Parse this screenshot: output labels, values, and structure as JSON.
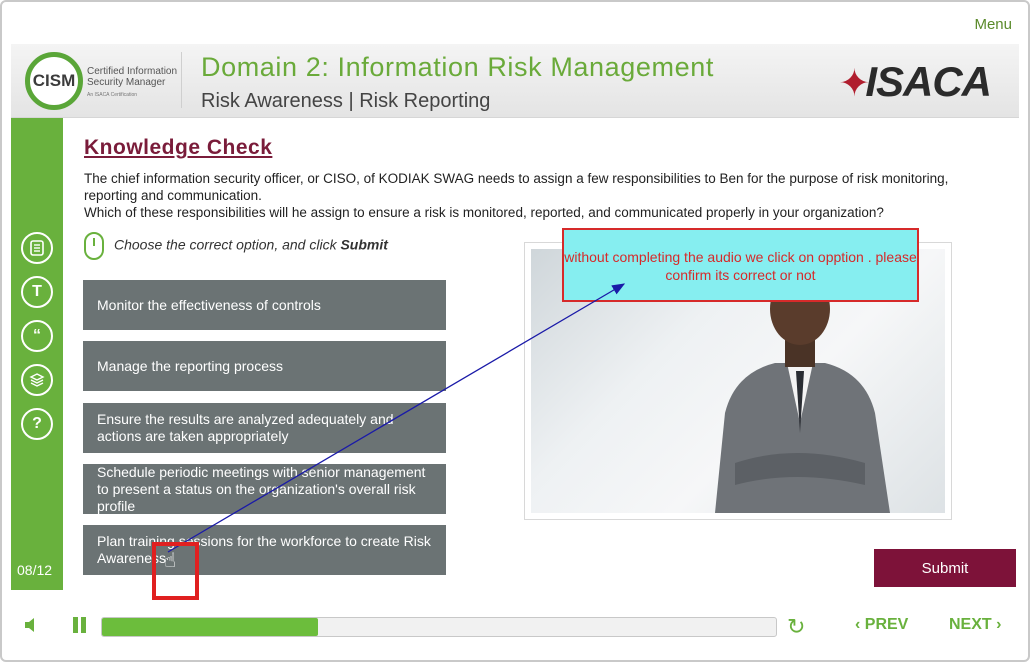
{
  "menu_label": "Menu",
  "header": {
    "cism_badge": "CISM",
    "cism_line1": "Certified Information",
    "cism_line2": "Security Manager",
    "cism_sub": "An ISACA Certification",
    "domain_title": "Domain 2: Information Risk Management",
    "domain_subtitle": "Risk Awareness | Risk Reporting",
    "brand": "ISACA"
  },
  "sidebar": {
    "icons": [
      "notes-icon",
      "transcript-icon",
      "quote-icon",
      "resources-icon",
      "help-icon"
    ],
    "page_counter": "08/12"
  },
  "main": {
    "kc_title": "Knowledge Check",
    "question_line1": "The chief information security officer, or CISO, of KODIAK SWAG needs to assign a few responsibilities to Ben for the purpose of risk monitoring, reporting and communication.",
    "question_line2": "Which of these responsibilities will he assign to ensure a risk is monitored, reported, and communicated properly in your organization?",
    "instruction_prefix": "Choose the correct option, and click ",
    "instruction_submit": "Submit",
    "options": [
      {
        "label": "Monitor the effectiveness of controls"
      },
      {
        "label": "Manage the reporting process"
      },
      {
        "label": "Ensure the results are analyzed adequately and actions are taken appropriately"
      },
      {
        "label": "Schedule periodic meetings with senior management to present a status on the organization's overall risk profile"
      },
      {
        "label": "Plan training sessions for the workforce to create Risk Awareness"
      }
    ],
    "submit_label": "Submit"
  },
  "annotation": {
    "callout_text": "without completing the audio we click on opption . please confirm its correct or not"
  },
  "player": {
    "progress": 0.32,
    "prev_label": "PREV",
    "next_label": "NEXT"
  },
  "colors": {
    "accent_green": "#69b13d",
    "option_gray": "#6b7374",
    "submit_maroon": "#7d1239",
    "callout_bg": "#86eef0",
    "callout_border": "#d62a2a"
  }
}
